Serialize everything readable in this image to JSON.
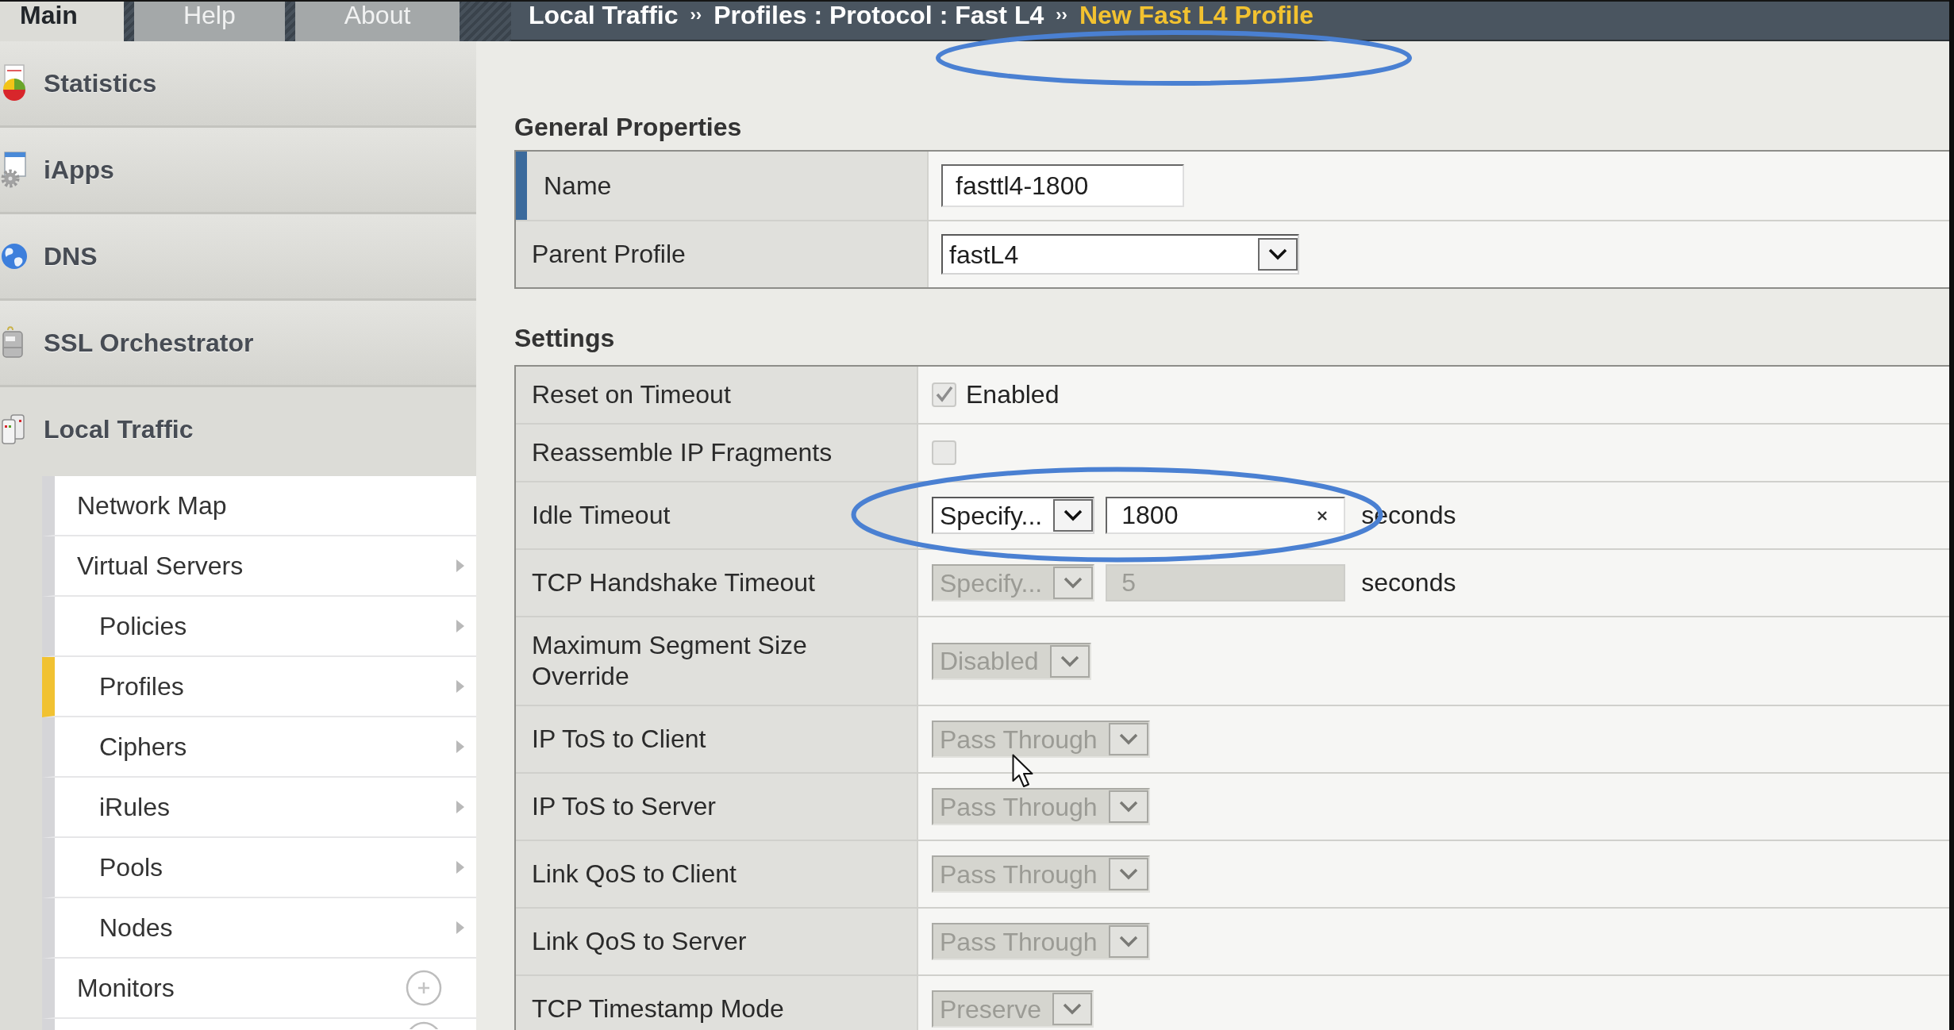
{
  "tabs": [
    {
      "label": "Main",
      "selected": true
    },
    {
      "label": "Help",
      "selected": false
    },
    {
      "label": "About",
      "selected": false
    }
  ],
  "breadcrumb": {
    "circled": true,
    "parts": [
      {
        "kind": "link",
        "text": "Local Traffic"
      },
      {
        "kind": "separator",
        "text": "››"
      },
      {
        "kind": "link",
        "text": "Profiles : Protocol : Fast L4"
      },
      {
        "kind": "separator",
        "text": "››"
      },
      {
        "kind": "current",
        "text": "New Fast L4 Profile"
      }
    ]
  },
  "sidebar": {
    "items": [
      {
        "label": "Statistics",
        "expanded": false
      },
      {
        "label": "iApps",
        "expanded": false
      },
      {
        "label": "DNS",
        "expanded": false
      },
      {
        "label": "SSL Orchestrator",
        "expanded": false
      },
      {
        "label": "Local Traffic",
        "expanded": true,
        "children": [
          {
            "label": "Network Map",
            "kind": "link",
            "selected": false
          },
          {
            "label": "Virtual Servers",
            "kind": "menu",
            "selected": false,
            "children": [
              {
                "label": "Policies",
                "kind": "menu",
                "selected": false
              },
              {
                "label": "Profiles",
                "kind": "menu",
                "selected": true
              },
              {
                "label": "Ciphers",
                "kind": "menu",
                "selected": false
              },
              {
                "label": "iRules",
                "kind": "menu",
                "selected": false
              },
              {
                "label": "Pools",
                "kind": "menu",
                "selected": false
              },
              {
                "label": "Nodes",
                "kind": "menu",
                "selected": false
              }
            ]
          },
          {
            "label": "Monitors",
            "kind": "add",
            "selected": false
          },
          {
            "kind": "add",
            "selected": false
          }
        ]
      }
    ]
  },
  "general_properties": {
    "title": "General Properties",
    "rows": [
      {
        "label": "Name",
        "required": true,
        "kind": "text",
        "value": "fasttl4-1800"
      },
      {
        "label": "Parent Profile",
        "required": false,
        "kind": "select",
        "value": "fastL4"
      }
    ]
  },
  "settings": {
    "title": "Settings",
    "rows": [
      {
        "label": "Reset on Timeout",
        "kind": "checkbox",
        "checked": true,
        "disabled": true,
        "option": "Enabled",
        "circled": false,
        "pointer": false
      },
      {
        "label": "Reassemble IP Fragments",
        "kind": "checkbox",
        "checked": false,
        "disabled": true,
        "circled": false,
        "pointer": false
      },
      {
        "label": "Idle Timeout",
        "kind": "timeout",
        "select": "Specify...",
        "value": "1800",
        "unit": "seconds",
        "disabled": false,
        "clearable": true,
        "circled": true,
        "pointer": false
      },
      {
        "label": "TCP Handshake Timeout",
        "kind": "timeout",
        "select": "Specify...",
        "value": "5",
        "unit": "seconds",
        "disabled": true,
        "clearable": false,
        "circled": false,
        "pointer": false
      },
      {
        "label": "Maximum Segment Size Override",
        "kind": "select",
        "value": "Disabled",
        "disabled": true,
        "circled": false,
        "pointer": false
      },
      {
        "label": "IP ToS to Client",
        "kind": "select",
        "value": "Pass Through",
        "disabled": true,
        "circled": false,
        "pointer": true
      },
      {
        "label": "IP ToS to Server",
        "kind": "select",
        "value": "Pass Through",
        "disabled": true,
        "circled": false,
        "pointer": false
      },
      {
        "label": "Link QoS to Client",
        "kind": "select",
        "value": "Pass Through",
        "disabled": true,
        "circled": false,
        "pointer": false
      },
      {
        "label": "Link QoS to Server",
        "kind": "select",
        "value": "Pass Through",
        "disabled": true,
        "circled": false,
        "pointer": false
      },
      {
        "label": "TCP Timestamp Mode",
        "kind": "select",
        "value": "Preserve",
        "disabled": true,
        "circled": false,
        "pointer": false
      }
    ]
  }
}
